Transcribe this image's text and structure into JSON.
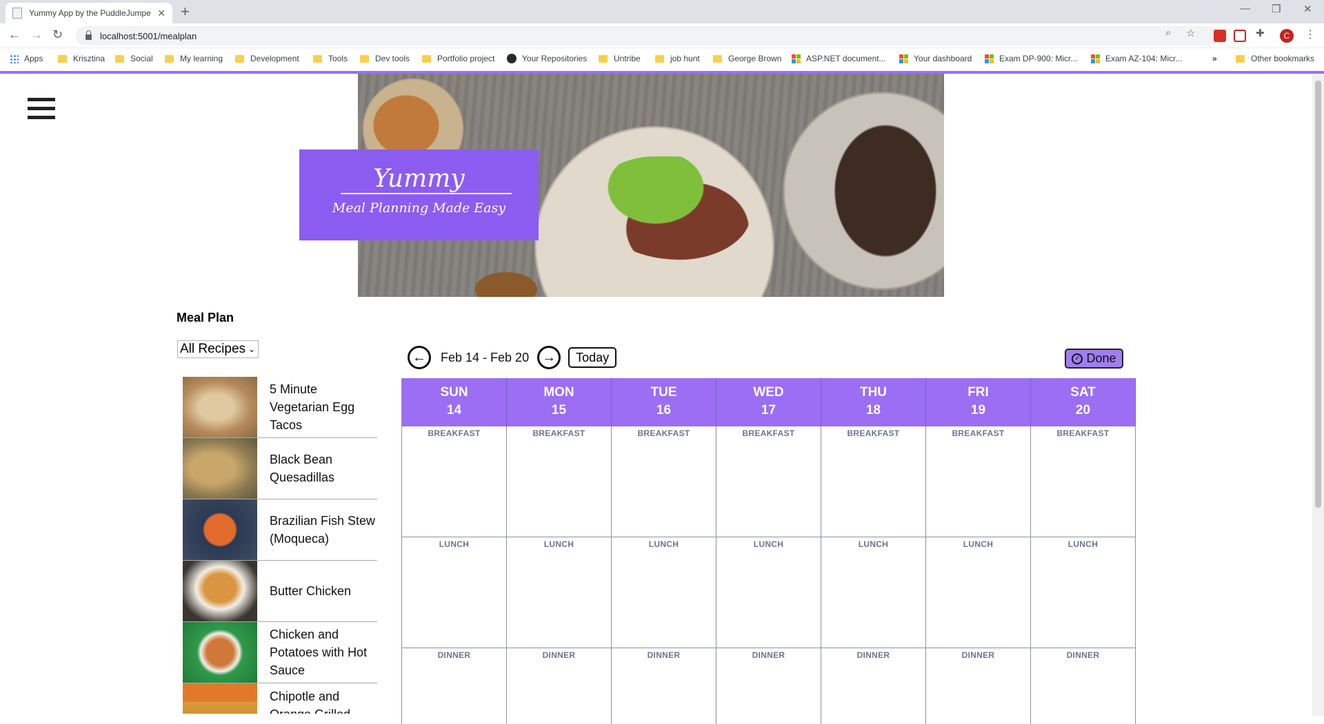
{
  "browser": {
    "tab_title": "Yummy App by the PuddleJumpe",
    "url": "localhost:5001/mealplan",
    "bookmarks": [
      {
        "label": "Apps",
        "icon": "apps-grid-icon"
      },
      {
        "label": "Krisztina",
        "icon": "folder-icon"
      },
      {
        "label": "Social",
        "icon": "folder-icon"
      },
      {
        "label": "My learning",
        "icon": "folder-icon"
      },
      {
        "label": "Development",
        "icon": "folder-icon"
      },
      {
        "label": "Tools",
        "icon": "folder-icon"
      },
      {
        "label": "Dev tools",
        "icon": "folder-icon"
      },
      {
        "label": "Portfolio project",
        "icon": "folder-icon"
      },
      {
        "label": "Your Repositories",
        "icon": "github-icon"
      },
      {
        "label": "Untribe",
        "icon": "folder-icon"
      },
      {
        "label": "job hunt",
        "icon": "folder-icon"
      },
      {
        "label": "George Brown",
        "icon": "folder-icon"
      },
      {
        "label": "ASP.NET document...",
        "icon": "microsoft-icon"
      },
      {
        "label": "Your dashboard",
        "icon": "microsoft-icon"
      },
      {
        "label": "Exam DP-900: Micr...",
        "icon": "microsoft-icon"
      },
      {
        "label": "Exam AZ-104: Micr...",
        "icon": "microsoft-icon"
      },
      {
        "label": "»",
        "icon": "more-bookmarks"
      },
      {
        "label": "Other bookmarks",
        "icon": "folder-icon"
      }
    ],
    "profile_initial": "C",
    "colors": {
      "tabstrip": "#dee1e6",
      "folder": "#f9cf4c",
      "profile": "#c5221f"
    }
  },
  "app": {
    "logo_title": "Yummy",
    "logo_subtitle": "Meal Planning Made Easy",
    "section_title": "Meal Plan",
    "recipe_filter": "All Recipes",
    "recipes": [
      {
        "name": "5 Minute Vegetarian Egg Tacos",
        "thumb": "#b58a5b"
      },
      {
        "name": "Black Bean Quesadillas",
        "thumb": "#8d7a52"
      },
      {
        "name": "Brazilian Fish Stew (Moqueca)",
        "thumb": "#c8542a"
      },
      {
        "name": "Butter Chicken",
        "thumb": "#c9893e"
      },
      {
        "name": "Chicken and Potatoes with Hot Sauce",
        "thumb": "#3f9a4e"
      },
      {
        "name": "Chipotle and Orange Grilled",
        "thumb": "#d99a3a"
      }
    ],
    "week_range": "Feb 14 - Feb 20",
    "today_label": "Today",
    "done_label": "Done",
    "days": [
      {
        "name": "SUN",
        "date": "14"
      },
      {
        "name": "MON",
        "date": "15"
      },
      {
        "name": "TUE",
        "date": "16"
      },
      {
        "name": "WED",
        "date": "17"
      },
      {
        "name": "THU",
        "date": "18"
      },
      {
        "name": "FRI",
        "date": "19"
      },
      {
        "name": "SAT",
        "date": "20"
      }
    ],
    "meals": [
      "BREAKFAST",
      "LUNCH",
      "DINNER"
    ],
    "colors": {
      "accent": "#9b6ef3",
      "logo_box": "#8c5cf0",
      "done_button": "#a07ef2",
      "meal_label": "#6c7390"
    }
  }
}
